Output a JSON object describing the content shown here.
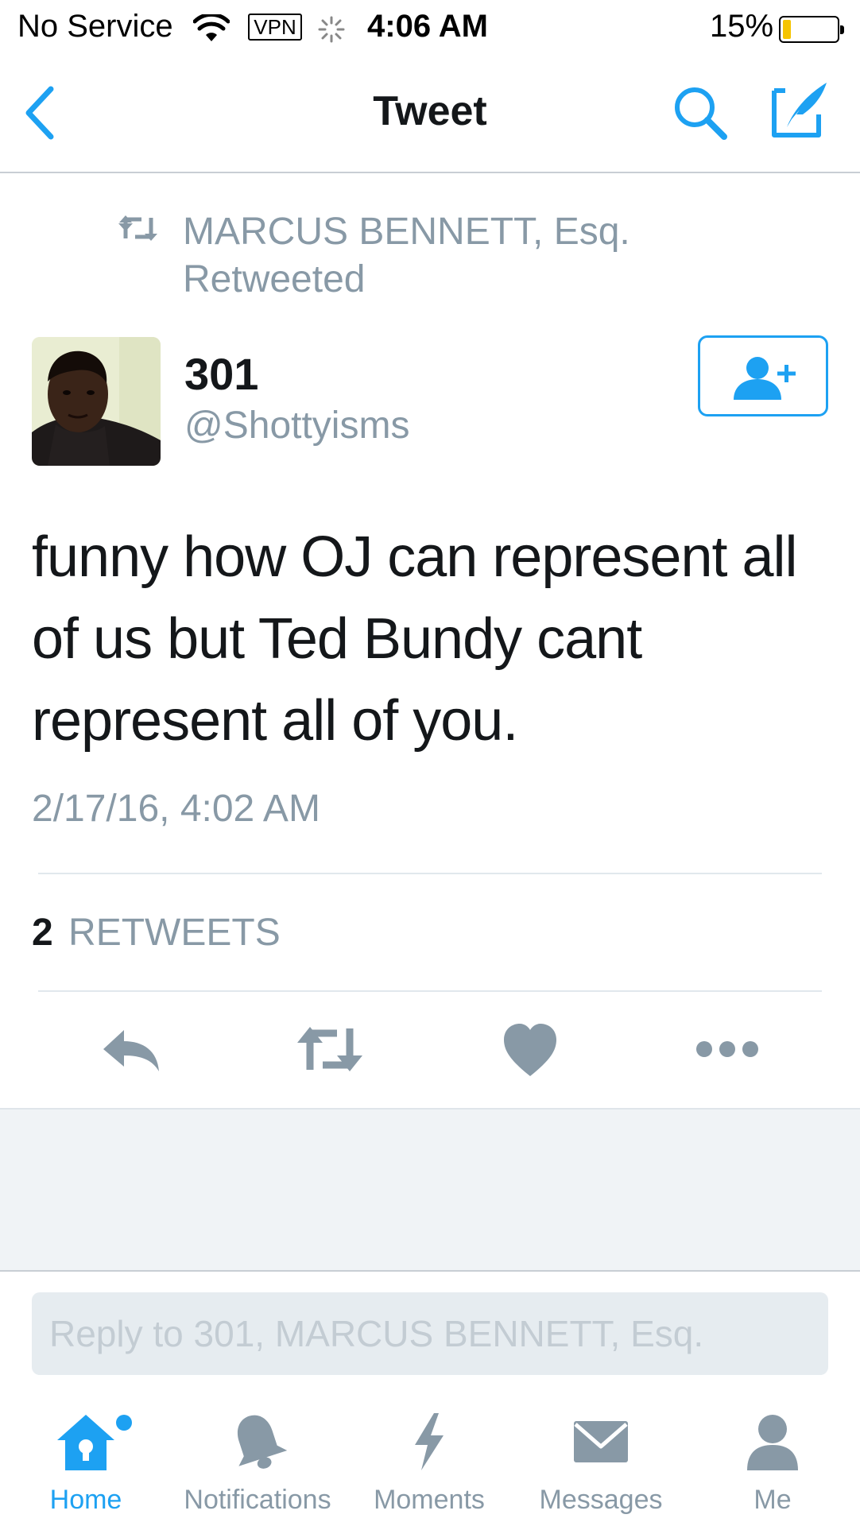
{
  "status_bar": {
    "carrier": "No Service",
    "vpn": "VPN",
    "time": "4:06 AM",
    "battery_percent": "15%",
    "battery_level": 0.15
  },
  "nav": {
    "title": "Tweet"
  },
  "retweet_context": {
    "text": "MARCUS BENNETT, Esq. Retweeted"
  },
  "author": {
    "name": "301",
    "handle": "@Shottyisms"
  },
  "tweet": {
    "text": "funny how OJ can represent all of us but Ted Bundy cant represent all of you.",
    "timestamp": "2/17/16, 4:02 AM"
  },
  "stats": {
    "retweet_count": "2",
    "retweet_label": "RETWEETS"
  },
  "reply": {
    "placeholder": "Reply to 301, MARCUS BENNETT, Esq."
  },
  "tabs": [
    {
      "label": "Home",
      "icon": "home-icon",
      "active": true
    },
    {
      "label": "Notifications",
      "icon": "bell-icon",
      "active": false
    },
    {
      "label": "Moments",
      "icon": "lightning-icon",
      "active": false
    },
    {
      "label": "Messages",
      "icon": "envelope-icon",
      "active": false
    },
    {
      "label": "Me",
      "icon": "person-icon",
      "active": false
    }
  ],
  "colors": {
    "accent": "#1da1f2",
    "muted": "#8899a6",
    "text": "#14171a",
    "battery": "#f5c400"
  }
}
